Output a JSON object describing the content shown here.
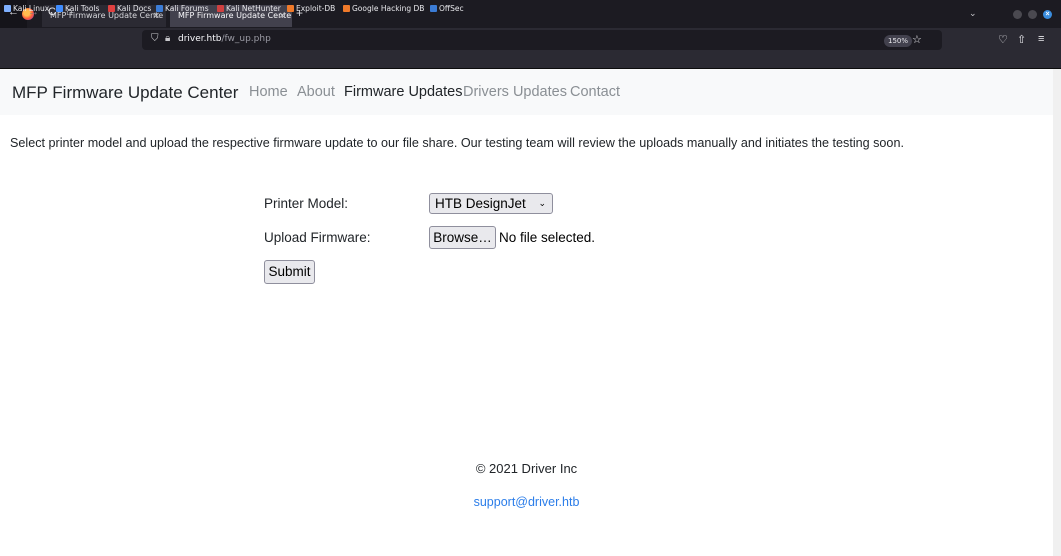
{
  "browser": {
    "tabs": [
      {
        "label": "MFP Firmware Update Cente",
        "close": "×"
      },
      {
        "label": "MFP Firmware Update Cente",
        "close": "×"
      }
    ],
    "new_tab": "+",
    "list_all_tabs": "⌄",
    "nav": {
      "back": "←",
      "forward": "→",
      "reload": "C",
      "home": "⌂"
    },
    "url": {
      "host": "driver.htb",
      "path": "/fw_up.php"
    },
    "zoom": "150%",
    "bookmark_star": "☆",
    "bookmarks": [
      {
        "label": "Kali Linux",
        "color": "#7fb0ff"
      },
      {
        "label": "Kali Tools",
        "color": "#3f8cff"
      },
      {
        "label": "Kali Docs",
        "color": "#e04040"
      },
      {
        "label": "Kali Forums",
        "color": "#3b7cd6"
      },
      {
        "label": "Kali NetHunter",
        "color": "#d04040"
      },
      {
        "label": "Exploit-DB",
        "color": "#f07a2a"
      },
      {
        "label": "Google Hacking DB",
        "color": "#f07a2a"
      },
      {
        "label": "OffSec",
        "color": "#3b7cd6"
      }
    ]
  },
  "site": {
    "brand": "MFP Firmware Update Center",
    "nav": [
      "Home",
      "About",
      "Firmware Updates",
      "Drivers Updates",
      "Contact"
    ],
    "active_nav": "Firmware Updates",
    "intro": "Select printer model and upload the respective firmware update to our file share. Our testing team will review the uploads manually and initiates the testing soon.",
    "form": {
      "printer_model_label": "Printer Model:",
      "printer_model_value": "HTB DesignJet",
      "upload_label": "Upload Firmware:",
      "browse_label": "Browse…",
      "no_file": "No file selected.",
      "submit_label": "Submit"
    },
    "footer": {
      "copyright": "© 2021 Driver Inc",
      "support_email": "support@driver.htb"
    }
  },
  "colors": {
    "link": "#2b7de9",
    "nav_muted": "#8a8f94",
    "navbar_bg": "#f8f9fa"
  }
}
